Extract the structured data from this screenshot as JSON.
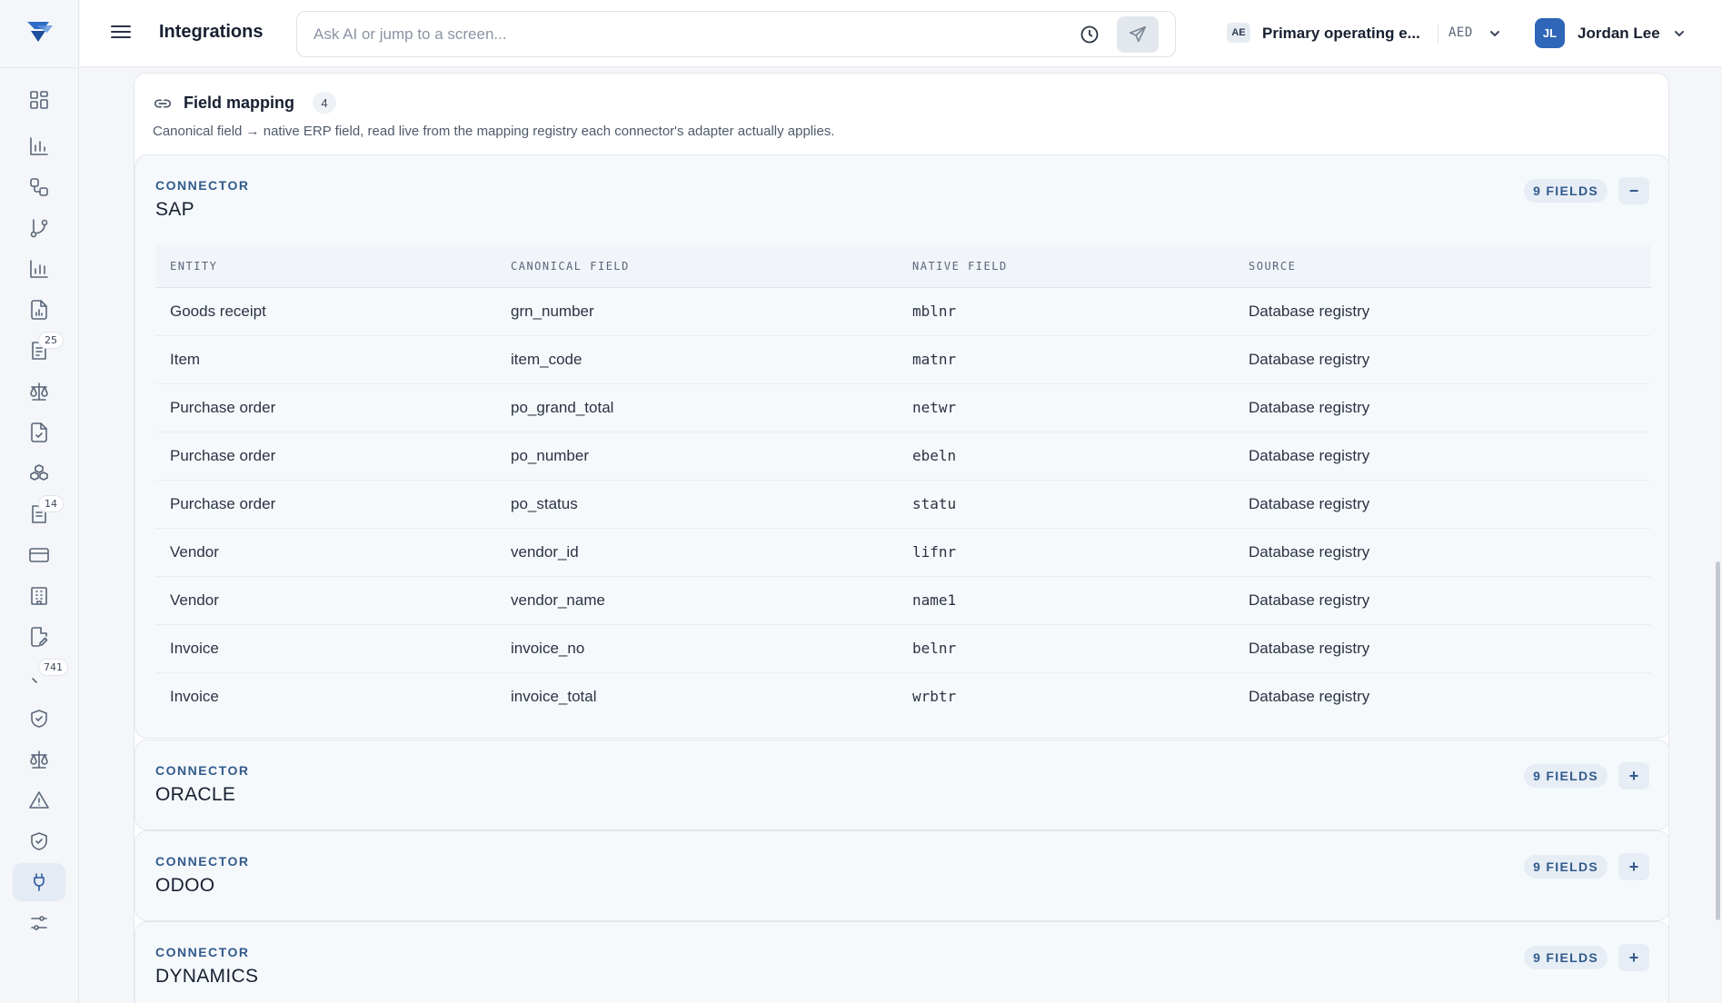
{
  "header": {
    "page_title": "Integrations",
    "search_placeholder": "Ask AI or jump to a screen...",
    "entity_code": "AE",
    "entity_name": "Primary operating e...",
    "currency": "AED",
    "user_initials": "JL",
    "user_name": "Jordan Lee"
  },
  "sidebar": {
    "badges": {
      "item_7": "25",
      "item_11": "14",
      "item_14": "741"
    }
  },
  "panel": {
    "title": "Field mapping",
    "count": "4",
    "subtitle": "Canonical field → native ERP field, read live from the mapping registry each connector's adapter actually applies."
  },
  "table_headers": [
    "ENTITY",
    "CANONICAL FIELD",
    "NATIVE FIELD",
    "SOURCE"
  ],
  "connectors": [
    {
      "label": "CONNECTOR",
      "name": "SAP",
      "fields_badge": "9 FIELDS",
      "toggle": "−",
      "expanded": true,
      "rows": [
        [
          "Goods receipt",
          "grn_number",
          "mblnr",
          "Database registry"
        ],
        [
          "Item",
          "item_code",
          "matnr",
          "Database registry"
        ],
        [
          "Purchase order",
          "po_grand_total",
          "netwr",
          "Database registry"
        ],
        [
          "Purchase order",
          "po_number",
          "ebeln",
          "Database registry"
        ],
        [
          "Purchase order",
          "po_status",
          "statu",
          "Database registry"
        ],
        [
          "Vendor",
          "vendor_id",
          "lifnr",
          "Database registry"
        ],
        [
          "Vendor",
          "vendor_name",
          "name1",
          "Database registry"
        ],
        [
          "Invoice",
          "invoice_no",
          "belnr",
          "Database registry"
        ],
        [
          "Invoice",
          "invoice_total",
          "wrbtr",
          "Database registry"
        ]
      ]
    },
    {
      "label": "CONNECTOR",
      "name": "ORACLE",
      "fields_badge": "9 FIELDS",
      "toggle": "+",
      "expanded": false
    },
    {
      "label": "CONNECTOR",
      "name": "ODOO",
      "fields_badge": "9 FIELDS",
      "toggle": "+",
      "expanded": false
    },
    {
      "label": "CONNECTOR",
      "name": "DYNAMICS",
      "fields_badge": "9 FIELDS",
      "toggle": "+",
      "expanded": false
    }
  ]
}
